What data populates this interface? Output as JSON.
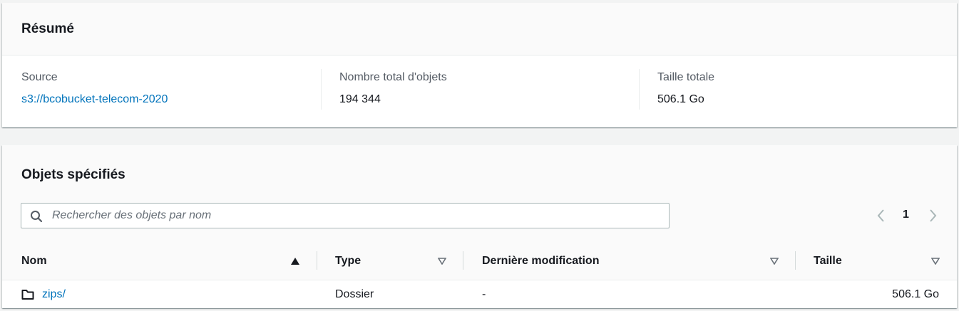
{
  "summary": {
    "title": "Résumé",
    "source_label": "Source",
    "source_value": "s3://bcobucket-telecom-2020",
    "count_label": "Nombre total d'objets",
    "count_value": "194 344",
    "size_label": "Taille totale",
    "size_value": "506.1 Go"
  },
  "objects": {
    "title": "Objets spécifiés",
    "search_placeholder": "Rechercher des objets par nom",
    "page": "1",
    "columns": [
      {
        "label": "Nom",
        "sort": "ascending"
      },
      {
        "label": "Type",
        "sort": "none"
      },
      {
        "label": "Dernière modification",
        "sort": "none"
      },
      {
        "label": "Taille",
        "sort": "none"
      }
    ],
    "rows": [
      {
        "name": "zips/",
        "type": "Dossier",
        "modified": "-",
        "size": "506.1 Go",
        "icon": "folder-icon"
      }
    ]
  },
  "colors": {
    "link": "#0073bb",
    "text": "#16191f",
    "muted": "#545b64",
    "header_bg": "#fafafa",
    "page_bg": "#f2f3f3"
  }
}
